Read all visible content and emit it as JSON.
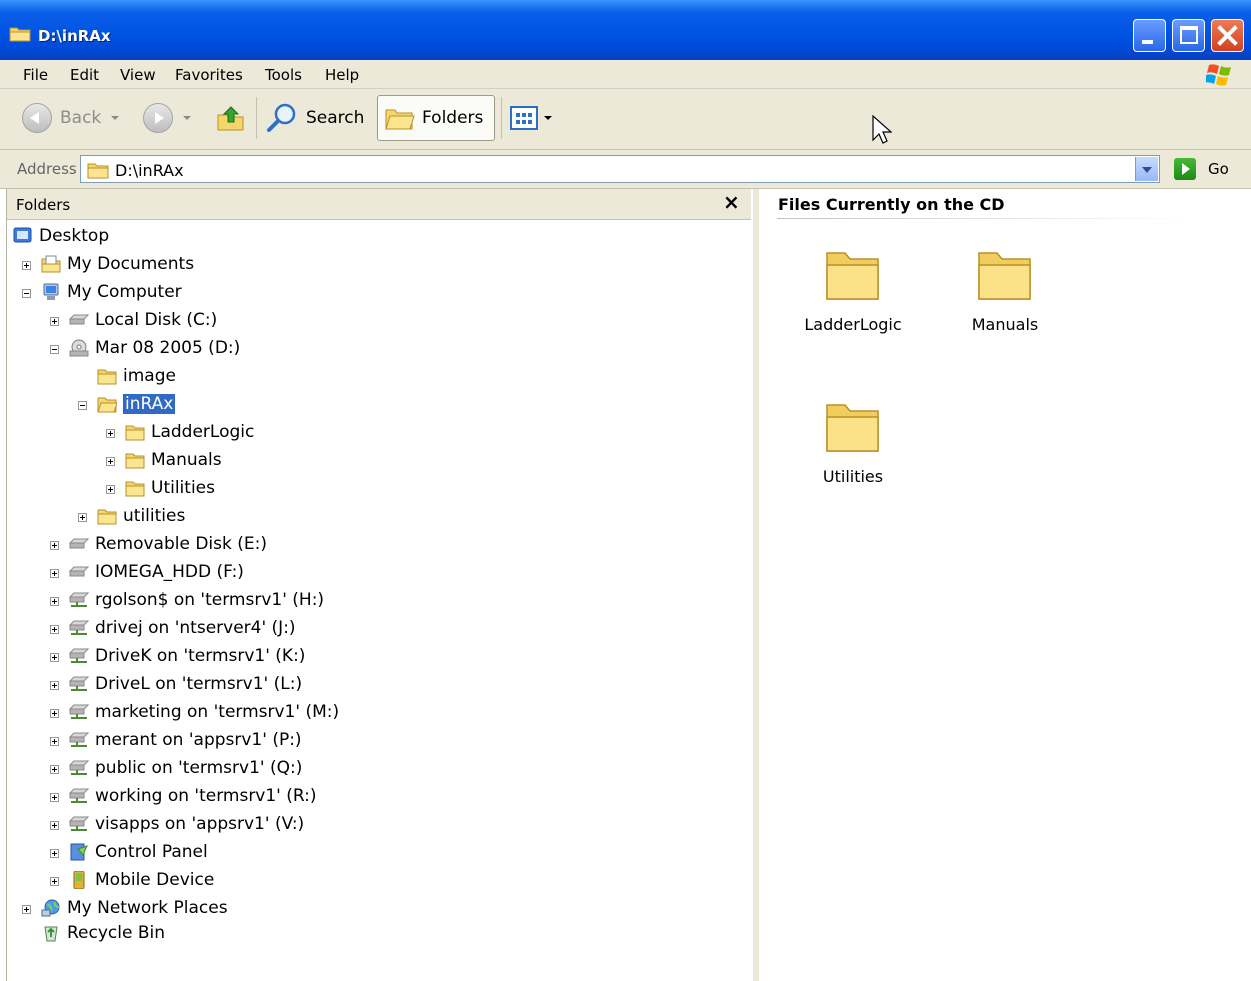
{
  "window": {
    "title": "D:\\inRAx"
  },
  "menu": {
    "items": [
      "File",
      "Edit",
      "View",
      "Favorites",
      "Tools",
      "Help"
    ]
  },
  "toolbar": {
    "back_label": "Back",
    "search_label": "Search",
    "folders_label": "Folders"
  },
  "address": {
    "label": "Address",
    "value": "D:\\inRAx",
    "go_label": "Go"
  },
  "folders_pane": {
    "title": "Folders",
    "close_glyph": "×",
    "tree": [
      {
        "label": "Desktop"
      },
      {
        "label": "My Documents"
      },
      {
        "label": "My Computer"
      },
      {
        "label": "Local Disk (C:)"
      },
      {
        "label": "Mar 08 2005 (D:)"
      },
      {
        "label": "image"
      },
      {
        "label": "inRAx"
      },
      {
        "label": "LadderLogic"
      },
      {
        "label": "Manuals"
      },
      {
        "label": "Utilities"
      },
      {
        "label": "utilities"
      },
      {
        "label": "Removable Disk (E:)"
      },
      {
        "label": "IOMEGA_HDD (F:)"
      },
      {
        "label": "rgolson$ on 'termsrv1' (H:)"
      },
      {
        "label": "drivej on 'ntserver4' (J:)"
      },
      {
        "label": "DriveK on 'termsrv1' (K:)"
      },
      {
        "label": "DriveL on 'termsrv1' (L:)"
      },
      {
        "label": "marketing on 'termsrv1' (M:)"
      },
      {
        "label": "merant on 'appsrv1' (P:)"
      },
      {
        "label": "public on 'termsrv1' (Q:)"
      },
      {
        "label": "working on 'termsrv1' (R:)"
      },
      {
        "label": "visapps on 'appsrv1' (V:)"
      },
      {
        "label": "Control Panel"
      },
      {
        "label": "Mobile Device"
      },
      {
        "label": "My Network Places"
      },
      {
        "label": "Recycle Bin"
      }
    ]
  },
  "content": {
    "title": "Files Currently on the CD",
    "items": [
      {
        "label": "LadderLogic"
      },
      {
        "label": "Manuals"
      },
      {
        "label": "Utilities"
      }
    ]
  }
}
